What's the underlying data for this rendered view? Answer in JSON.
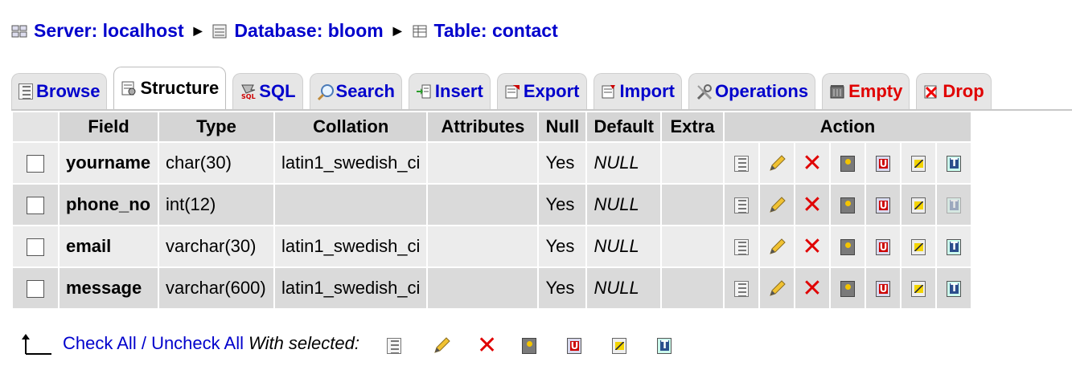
{
  "breadcrumb": {
    "server": "Server: localhost",
    "database": "Database: bloom",
    "table": "Table: contact"
  },
  "tabs": [
    {
      "label": "Browse",
      "icon": "browse-icon"
    },
    {
      "label": "Structure",
      "icon": "structure-icon"
    },
    {
      "label": "SQL",
      "icon": "sql-icon"
    },
    {
      "label": "Search",
      "icon": "search-icon"
    },
    {
      "label": "Insert",
      "icon": "insert-icon"
    },
    {
      "label": "Export",
      "icon": "export-icon"
    },
    {
      "label": "Import",
      "icon": "import-icon"
    },
    {
      "label": "Operations",
      "icon": "operations-icon"
    },
    {
      "label": "Empty",
      "icon": "empty-icon"
    },
    {
      "label": "Drop",
      "icon": "drop-icon"
    }
  ],
  "active_tab": "Structure",
  "columns": [
    "Field",
    "Type",
    "Collation",
    "Attributes",
    "Null",
    "Default",
    "Extra",
    "Action"
  ],
  "rows": [
    {
      "field": "yourname",
      "type": "char(30)",
      "collation": "latin1_swedish_ci",
      "attributes": "",
      "null": "Yes",
      "default": "NULL",
      "extra": ""
    },
    {
      "field": "phone_no",
      "type": "int(12)",
      "collation": "",
      "attributes": "",
      "null": "Yes",
      "default": "NULL",
      "extra": ""
    },
    {
      "field": "email",
      "type": "varchar(30)",
      "collation": "latin1_swedish_ci",
      "attributes": "",
      "null": "Yes",
      "default": "NULL",
      "extra": ""
    },
    {
      "field": "message",
      "type": "varchar(600)",
      "collation": "latin1_swedish_ci",
      "attributes": "",
      "null": "Yes",
      "default": "NULL",
      "extra": ""
    }
  ],
  "action_icons": [
    "browse-distinct-icon",
    "edit-pencil-icon",
    "drop-x-icon",
    "primary-key-icon",
    "unique-icon",
    "index-icon",
    "fulltext-icon"
  ],
  "footer": {
    "check_all": "Check All",
    "slash": " / ",
    "uncheck_all": "Uncheck All",
    "with_selected": "With selected:"
  },
  "colors": {
    "link": "#0000cc",
    "danger": "#e00000",
    "header_bg": "#d5d5d5"
  }
}
